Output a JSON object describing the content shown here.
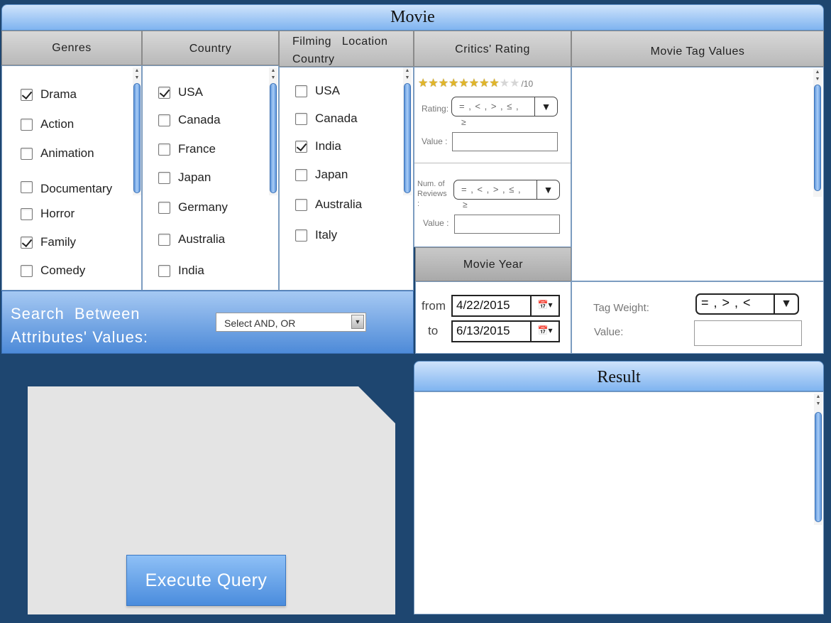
{
  "movie": {
    "title": "Movie"
  },
  "genres": {
    "header": "Genres",
    "items": [
      {
        "label": "Drama",
        "checked": true
      },
      {
        "label": "Action",
        "checked": false
      },
      {
        "label": "Animation",
        "checked": false
      },
      {
        "label": "Documentary",
        "checked": false
      },
      {
        "label": "Horror",
        "checked": false
      },
      {
        "label": "Family",
        "checked": true
      },
      {
        "label": "Comedy",
        "checked": false
      }
    ]
  },
  "country": {
    "header": "Country",
    "items": [
      {
        "label": "USA",
        "checked": true
      },
      {
        "label": "Canada",
        "checked": false
      },
      {
        "label": "France",
        "checked": false
      },
      {
        "label": "Japan",
        "checked": false
      },
      {
        "label": "Germany",
        "checked": false
      },
      {
        "label": "Australia",
        "checked": false
      },
      {
        "label": "India",
        "checked": false
      }
    ]
  },
  "filming": {
    "header_line1": "Filming   Location",
    "header_line2": "Country",
    "items": [
      {
        "label": "USA",
        "checked": false
      },
      {
        "label": "Canada",
        "checked": false
      },
      {
        "label": "India",
        "checked": true
      },
      {
        "label": "Japan",
        "checked": false
      },
      {
        "label": "Australia",
        "checked": false
      },
      {
        "label": "Italy",
        "checked": false
      }
    ]
  },
  "critics": {
    "header": "Critics' Rating",
    "stars_filled": 8,
    "stars_total": 10,
    "scale_label": "/10",
    "rating_label": "Rating:",
    "rating_operator": "= , < , > , ≤ ,",
    "rating_operator_wrap": "≥",
    "value_label": "Value :",
    "reviews_label_line1": "Num. of",
    "reviews_label_line2": "Reviews",
    "reviews_label_line3": ":",
    "reviews_operator": "= , < , > , ≤ ,",
    "reviews_operator_wrap": "≥",
    "reviews_value_label": "Value :"
  },
  "movie_year": {
    "header": "Movie Year",
    "from_label": "from",
    "from_value": "4/22/2015",
    "to_label": "to",
    "to_value": "6/13/2015"
  },
  "tags": {
    "header": "Movie Tag Values",
    "weight_label": "Tag Weight:",
    "weight_operator": "= , > , <",
    "value_label": "Value:"
  },
  "search": {
    "label_line1": "Search  Between",
    "label_line2": "Attributes' Values:",
    "select_value": "Select AND, OR"
  },
  "execute": {
    "label": "Execute Query"
  },
  "result": {
    "title": "Result"
  },
  "icons": {
    "dropdown": "triangle-down-icon",
    "calendar": "calendar-icon",
    "star": "star-icon",
    "check": "check-icon"
  },
  "colors": {
    "background": "#1e4670",
    "accent": "#4a8cdd",
    "star": "#e0b52a"
  }
}
